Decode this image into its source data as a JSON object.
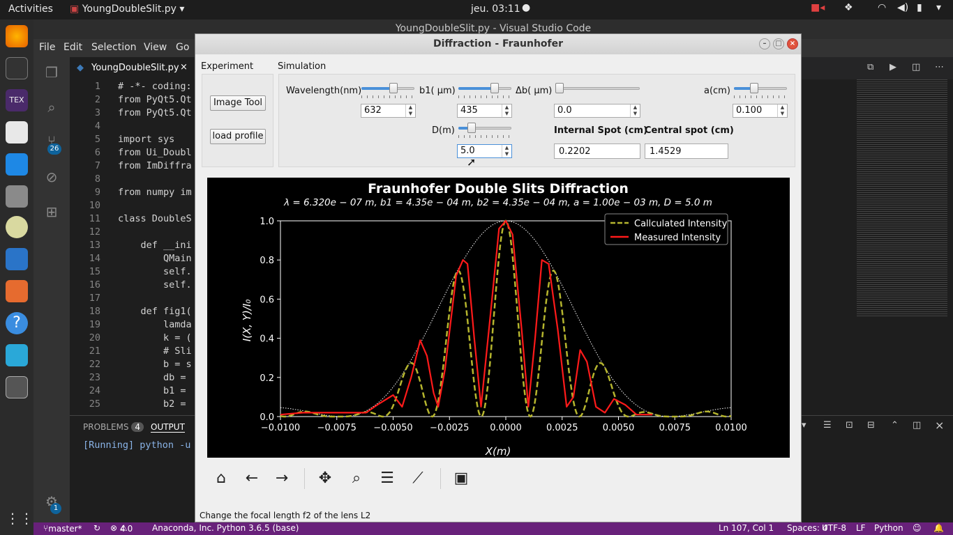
{
  "topbar": {
    "activities": "Activities",
    "app": "YoungDoubleSlit.py",
    "clock": "jeu. 03:11"
  },
  "vscode": {
    "title": "YoungDoubleSlit.py - Visual Studio Code",
    "menu": [
      "File",
      "Edit",
      "Selection",
      "View",
      "Go"
    ],
    "tab_label": "YoungDoubleSlit.py",
    "git_badge": "26",
    "settings_badge": "1",
    "code_lines": [
      {
        "n": "1",
        "t": "# -*- coding:"
      },
      {
        "n": "2",
        "t": "from PyQt5.Qt"
      },
      {
        "n": "3",
        "t": "from PyQt5.Qt"
      },
      {
        "n": "4",
        "t": ""
      },
      {
        "n": "5",
        "t": "import sys"
      },
      {
        "n": "6",
        "t": "from Ui_Doubl"
      },
      {
        "n": "7",
        "t": "from ImDiffra"
      },
      {
        "n": "8",
        "t": ""
      },
      {
        "n": "9",
        "t": "from numpy im"
      },
      {
        "n": "10",
        "t": ""
      },
      {
        "n": "11",
        "t": "class DoubleS"
      },
      {
        "n": "12",
        "t": ""
      },
      {
        "n": "13",
        "t": "    def __ini"
      },
      {
        "n": "14",
        "t": "        QMain"
      },
      {
        "n": "15",
        "t": "        self."
      },
      {
        "n": "16",
        "t": "        self."
      },
      {
        "n": "17",
        "t": ""
      },
      {
        "n": "18",
        "t": "    def fig1("
      },
      {
        "n": "19",
        "t": "        lamda"
      },
      {
        "n": "20",
        "t": "        k = ("
      },
      {
        "n": "21",
        "t": "        # Sli"
      },
      {
        "n": "22",
        "t": "        b = s"
      },
      {
        "n": "23",
        "t": "        db ="
      },
      {
        "n": "24",
        "t": "        b1 ="
      },
      {
        "n": "25",
        "t": "        b2 ="
      }
    ],
    "panel_tabs": {
      "problems": "PROBLEMS",
      "problems_count": "4",
      "output": "OUTPUT"
    },
    "output_text": "[Running] python -u",
    "status": {
      "branch": "master*",
      "errors": "4",
      "warnings": "0",
      "interpreter": "Anaconda, Inc. Python 3.6.5 (base)",
      "position": "Ln 107, Col 1",
      "spaces": "Spaces: 4",
      "encoding": "UTF-8",
      "eol": "LF",
      "language": "Python"
    }
  },
  "dialog": {
    "title": "Diffraction - Fraunhofer",
    "experiment_label": "Experiment",
    "simulation_label": "Simulation",
    "image_tool": "Image Tool",
    "load_profile": "load profile",
    "wavelength_label": "Wavelength(nm)",
    "wavelength_value": "632",
    "wavelength_slider": 0.63,
    "b1_label": "b1( μm)",
    "b1_value": "435",
    "b1_slider": 0.72,
    "db_label": "Δb( μm)",
    "db_value": "0.0",
    "db_slider": 0.0,
    "a_label": "a(cm)",
    "a_value": "0.100",
    "a_slider": 0.36,
    "d_label": "D(m)",
    "d_value": "5.0",
    "d_slider": 0.2,
    "internal_spot_label": "Internal Spot (cm)",
    "internal_spot_value": "0.2202",
    "central_spot_label": "Central spot (cm)",
    "central_spot_value": "1.4529",
    "status_text": "Change the focal length f2 of the lens L2"
  },
  "chart_data": {
    "type": "line",
    "title": "Fraunhofer Double Slits Diffraction",
    "subtitle": "λ = 6.320e − 07 m,  b1 = 4.35e − 04 m,  b2 = 4.35e − 04 m,  a = 1.00e − 03 m,  D = 5.0 m",
    "xlabel": "X(m)",
    "ylabel": "I(X, Y)/I₀",
    "xlim": [
      -0.01,
      0.01
    ],
    "ylim": [
      0,
      1
    ],
    "xticks": [
      "−0.0100",
      "−0.0075",
      "−0.0050",
      "−0.0025",
      "0.0000",
      "0.0025",
      "0.0050",
      "0.0075",
      "0.0100"
    ],
    "yticks": [
      "0.0",
      "0.2",
      "0.4",
      "0.6",
      "0.8",
      "1.0"
    ],
    "legend_position": "top-right",
    "series": [
      {
        "name": "Callculated Intensity",
        "color": "#b5b52e",
        "style": "dashed",
        "model": "envelope*cos2",
        "fringe_period": 0.00218,
        "envelope_width": 0.0073
      },
      {
        "name": "Measured Intensity",
        "color": "#ff1a1a",
        "style": "solid",
        "points": [
          [
            -0.01,
            0.01
          ],
          [
            -0.009,
            0.02
          ],
          [
            -0.008,
            0.02
          ],
          [
            -0.007,
            0.02
          ],
          [
            -0.0062,
            0.02
          ],
          [
            -0.0057,
            0.06
          ],
          [
            -0.005,
            0.11
          ],
          [
            -0.0046,
            0.05
          ],
          [
            -0.0042,
            0.2
          ],
          [
            -0.0038,
            0.39
          ],
          [
            -0.0035,
            0.31
          ],
          [
            -0.0032,
            0.12
          ],
          [
            -0.003,
            0.05
          ],
          [
            -0.0027,
            0.24
          ],
          [
            -0.0022,
            0.72
          ],
          [
            -0.0019,
            0.8
          ],
          [
            -0.0017,
            0.78
          ],
          [
            -0.0014,
            0.4
          ],
          [
            -0.0011,
            0.05
          ],
          [
            -0.0007,
            0.5
          ],
          [
            -0.0003,
            0.96
          ],
          [
            0.0,
            1.0
          ],
          [
            0.0003,
            0.93
          ],
          [
            0.0007,
            0.45
          ],
          [
            0.001,
            0.05
          ],
          [
            0.0013,
            0.4
          ],
          [
            0.0016,
            0.8
          ],
          [
            0.0019,
            0.78
          ],
          [
            0.0023,
            0.45
          ],
          [
            0.0027,
            0.05
          ],
          [
            0.003,
            0.1
          ],
          [
            0.0033,
            0.34
          ],
          [
            0.0036,
            0.28
          ],
          [
            0.004,
            0.05
          ],
          [
            0.0044,
            0.02
          ],
          [
            0.0048,
            0.09
          ],
          [
            0.0053,
            0.06
          ],
          [
            0.0058,
            0.01
          ],
          [
            0.0065,
            0.01
          ]
        ]
      },
      {
        "name": "",
        "color": "#ffffff",
        "style": "dotted",
        "model": "envelope"
      }
    ]
  }
}
